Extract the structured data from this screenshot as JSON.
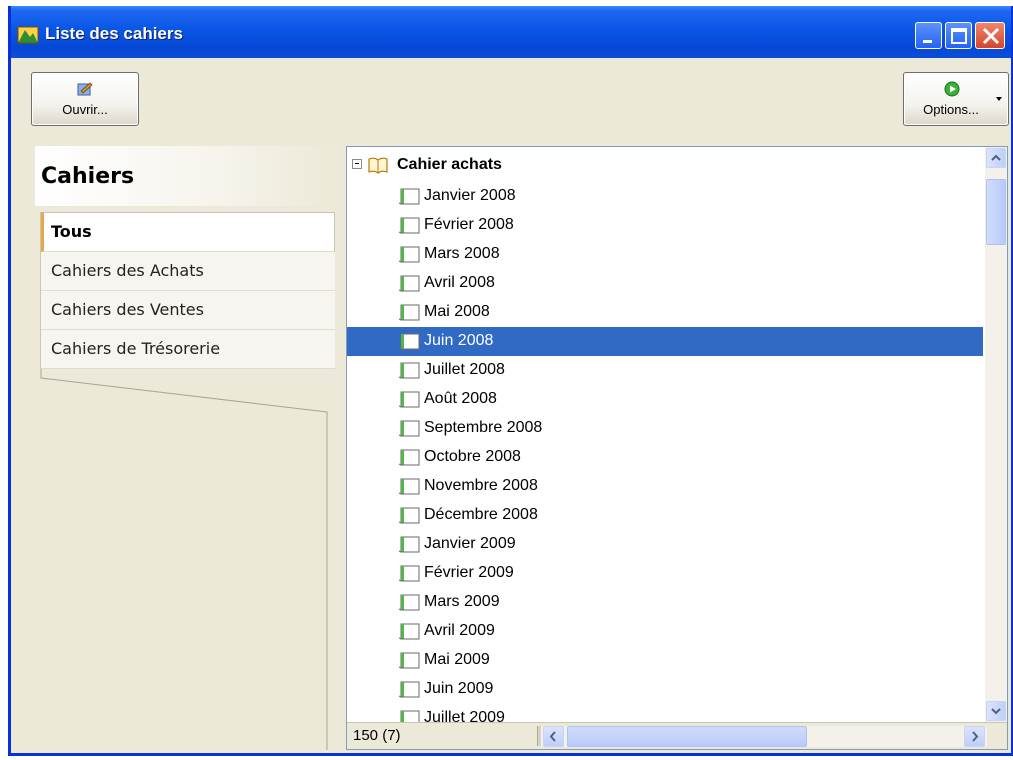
{
  "window": {
    "title": "Liste des cahiers",
    "accent_color": "#0a55e6",
    "icon": "ledger-app-icon",
    "controls": [
      "minimize-icon",
      "maximize-icon",
      "close-icon"
    ]
  },
  "toolbar": {
    "open_label": "Ouvrir...",
    "open_icon": "open-ledger-icon",
    "options_label": "Options...",
    "options_icon": "green-play-icon"
  },
  "sidebar": {
    "title": "Cahiers",
    "items": [
      {
        "label": "Tous",
        "selected": true
      },
      {
        "label": "Cahiers des Achats",
        "selected": false
      },
      {
        "label": "Cahiers des Ventes",
        "selected": false
      },
      {
        "label": "Cahiers de Trésorerie",
        "selected": false
      }
    ]
  },
  "tree": {
    "root_label": "Cahier achats",
    "root_icon": "open-book-icon",
    "item_icon": "ledger-book-icon",
    "selection_color": "#316ac5",
    "items": [
      {
        "label": "Janvier 2008",
        "selected": false
      },
      {
        "label": "Février 2008",
        "selected": false
      },
      {
        "label": "Mars 2008",
        "selected": false
      },
      {
        "label": "Avril 2008",
        "selected": false
      },
      {
        "label": "Mai 2008",
        "selected": false
      },
      {
        "label": "Juin 2008",
        "selected": true
      },
      {
        "label": "Juillet 2008",
        "selected": false
      },
      {
        "label": "Août 2008",
        "selected": false
      },
      {
        "label": "Septembre 2008",
        "selected": false
      },
      {
        "label": "Octobre 2008",
        "selected": false
      },
      {
        "label": "Novembre 2008",
        "selected": false
      },
      {
        "label": "Décembre 2008",
        "selected": false
      },
      {
        "label": "Janvier 2009",
        "selected": false
      },
      {
        "label": "Février 2009",
        "selected": false
      },
      {
        "label": "Mars 2009",
        "selected": false
      },
      {
        "label": "Avril 2009",
        "selected": false
      },
      {
        "label": "Mai 2009",
        "selected": false
      },
      {
        "label": "Juin 2009",
        "selected": false
      },
      {
        "label": "Juillet 2009",
        "selected": false
      }
    ]
  },
  "status": {
    "count_text": "150 (7)"
  }
}
